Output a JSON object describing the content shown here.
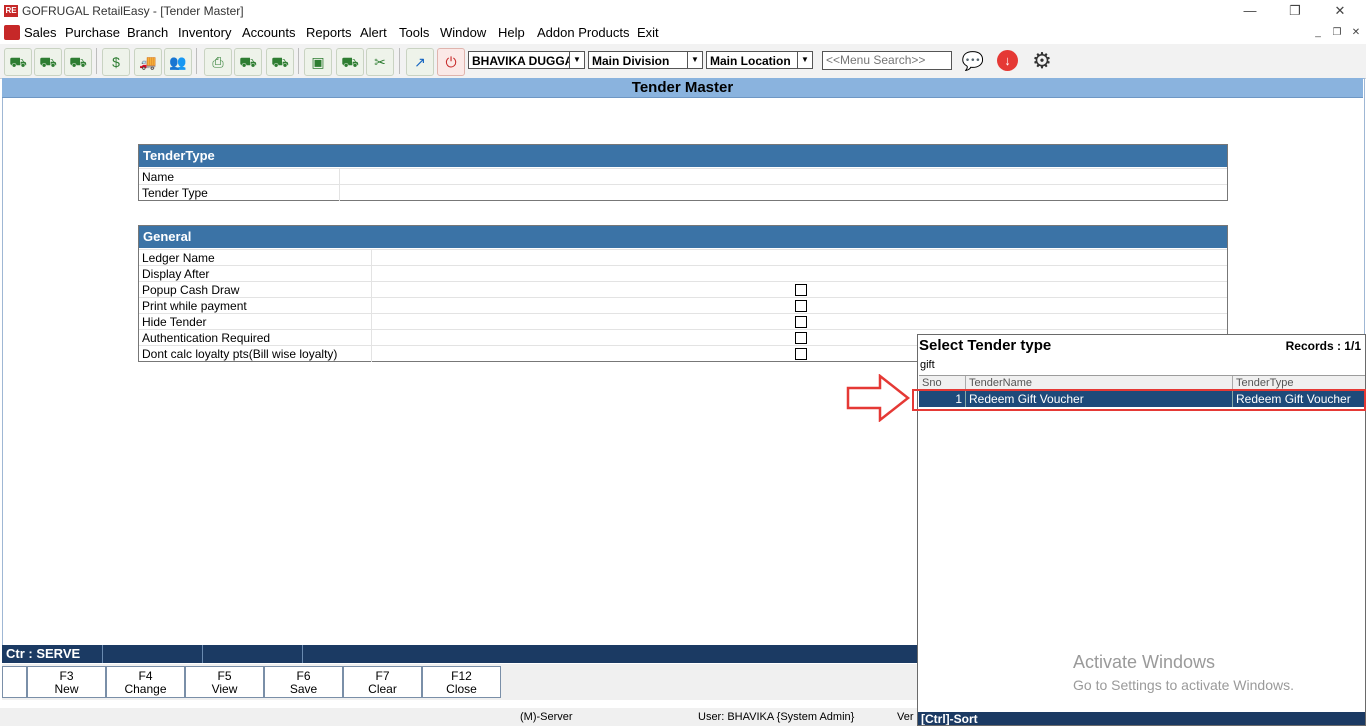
{
  "window": {
    "title": "GOFRUGAL RetailEasy - [Tender Master]",
    "app_icon_text": "RE"
  },
  "menubar": {
    "items": [
      "Sales",
      "Purchase",
      "Branch",
      "Inventory",
      "Accounts",
      "Reports",
      "Alert",
      "Tools",
      "Window",
      "Help",
      "Addon Products",
      "Exit"
    ]
  },
  "toolbar": {
    "user_combo": "BHAVIKA DUGGA",
    "division_combo": "Main Division",
    "location_combo": "Main Location",
    "menu_search_placeholder": "<<Menu Search>>"
  },
  "header": {
    "title": "Tender Master"
  },
  "tender_type_panel": {
    "title": "TenderType",
    "rows": [
      "Name",
      "Tender Type"
    ]
  },
  "general_panel": {
    "title": "General",
    "text_rows": [
      "Ledger Name",
      "Display After"
    ],
    "check_rows": [
      "Popup Cash Draw",
      "Print while payment",
      "Hide Tender",
      "Authentication Required",
      "Dont calc loyalty pts(Bill wise loyalty)"
    ]
  },
  "popup": {
    "title": "Select Tender type",
    "records": "Records : 1/1",
    "search_value": "gift",
    "columns": [
      "Sno",
      "TenderName",
      "TenderType"
    ],
    "rows": [
      {
        "sno": "1",
        "tender_name": "Redeem Gift Voucher",
        "tender_type": "Redeem Gift Voucher"
      }
    ],
    "footer": "[Ctrl]-Sort"
  },
  "counter": {
    "label": "Ctr : SERVE"
  },
  "fkeys": [
    {
      "key": "F3",
      "label": "New"
    },
    {
      "key": "F4",
      "label": "Change"
    },
    {
      "key": "F5",
      "label": "View"
    },
    {
      "key": "F6",
      "label": "Save"
    },
    {
      "key": "F7",
      "label": "Clear"
    },
    {
      "key": "F12",
      "label": "Close"
    }
  ],
  "statusbar": {
    "server": "(M)-Server",
    "user": "User: BHAVIKA {System Admin}",
    "version": "Ver"
  },
  "watermark": {
    "line1": "Activate Windows",
    "line2": "Go to Settings to activate Windows."
  },
  "colors": {
    "header_blue": "#8ab3de",
    "panel_head": "#3b73a6",
    "selected_row": "#1e4a7a",
    "highlight_red": "#e53935"
  }
}
